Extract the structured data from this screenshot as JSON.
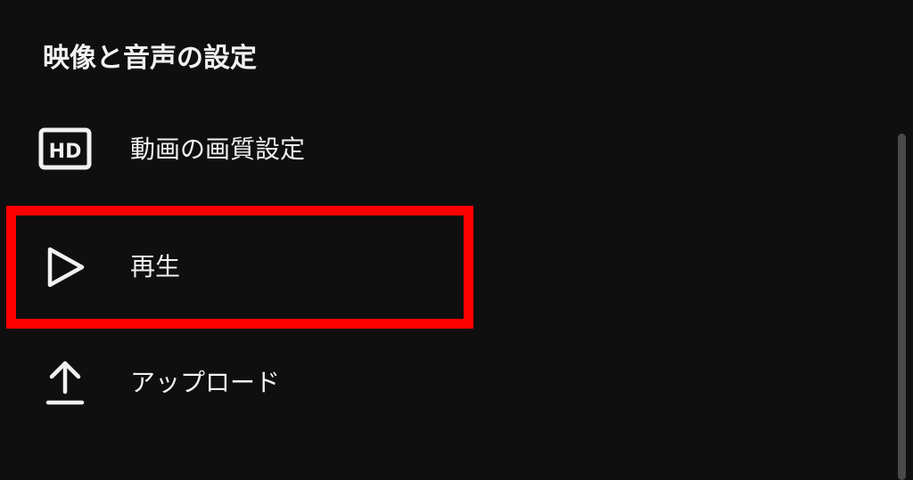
{
  "settings": {
    "title": "映像と音声の設定",
    "items": [
      {
        "icon": "hd-icon",
        "label": "動画の画質設定",
        "icon_text": "HD"
      },
      {
        "icon": "play-icon",
        "label": "再生"
      },
      {
        "icon": "upload-icon",
        "label": "アップロード"
      }
    ]
  },
  "colors": {
    "background": "#0f0f0f",
    "text": "#f1f1f1",
    "highlight": "#ff0000"
  }
}
